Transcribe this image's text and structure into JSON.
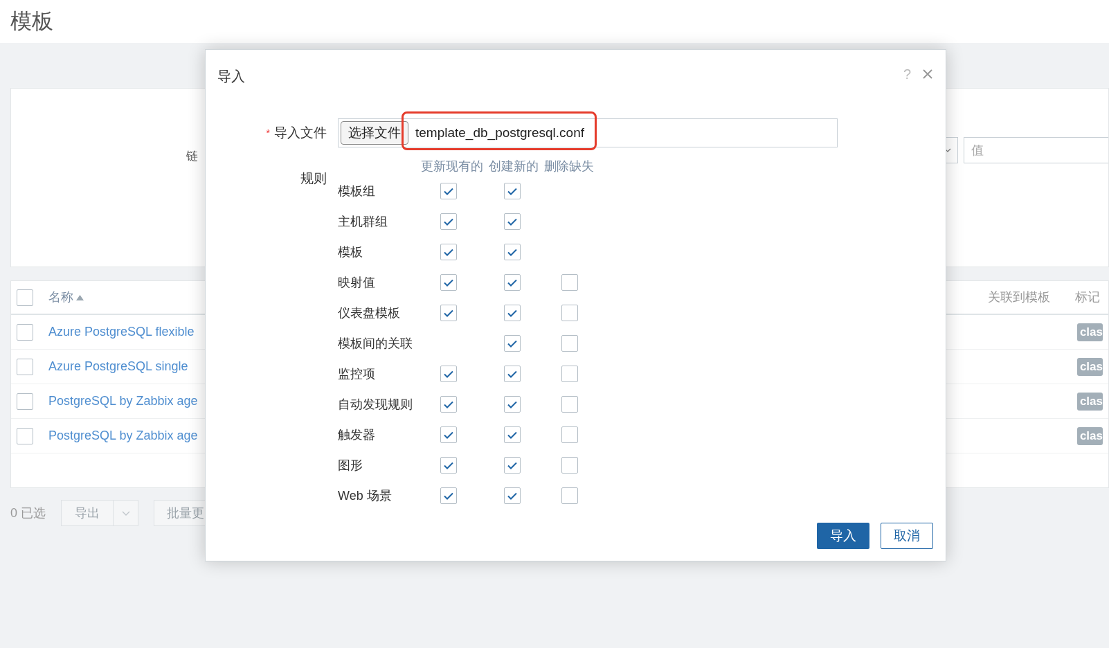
{
  "page": {
    "title": "模板"
  },
  "filter": {
    "label": "链",
    "value_placeholder": "值"
  },
  "table": {
    "header_checked": false,
    "columns": [
      "名称",
      "关联到模板",
      "标记"
    ],
    "rows": [
      {
        "name": "Azure PostgreSQL flexible",
        "tag": "clas",
        "checked": false
      },
      {
        "name": "Azure PostgreSQL single",
        "tag": "clas",
        "checked": false
      },
      {
        "name": "PostgreSQL by Zabbix age",
        "tag": "clas",
        "checked": false
      },
      {
        "name": "PostgreSQL by Zabbix age",
        "tag": "clas",
        "checked": false
      }
    ]
  },
  "footer": {
    "selected_count": "0 已选",
    "export": "导出",
    "mass_update": "批量更"
  },
  "dialog": {
    "title": "导入",
    "help": "?",
    "required_mark": "*",
    "file_label": "导入文件",
    "choose_button": "选择文件",
    "file_name": "template_db_postgresql.conf",
    "rules_label": "规则",
    "rule_columns": [
      "更新现有的",
      "创建新的",
      "删除缺失"
    ],
    "rules": [
      {
        "label": "模板组",
        "update": {
          "checked": true
        },
        "create": {
          "checked": true
        }
      },
      {
        "label": "主机群组",
        "update": {
          "checked": true
        },
        "create": {
          "checked": true
        }
      },
      {
        "label": "模板",
        "update": {
          "checked": true
        },
        "create": {
          "checked": true
        }
      },
      {
        "label": "映射值",
        "update": {
          "checked": true
        },
        "create": {
          "checked": true
        },
        "delete": {
          "checked": false
        }
      },
      {
        "label": "仪表盘模板",
        "update": {
          "checked": true
        },
        "create": {
          "checked": true
        },
        "delete": {
          "checked": false
        }
      },
      {
        "label": "模板间的关联",
        "create": {
          "checked": true
        },
        "delete": {
          "checked": false
        }
      },
      {
        "label": "监控项",
        "update": {
          "checked": true
        },
        "create": {
          "checked": true
        },
        "delete": {
          "checked": false
        }
      },
      {
        "label": "自动发现规则",
        "update": {
          "checked": true
        },
        "create": {
          "checked": true
        },
        "delete": {
          "checked": false
        }
      },
      {
        "label": "触发器",
        "update": {
          "checked": true
        },
        "create": {
          "checked": true
        },
        "delete": {
          "checked": false
        }
      },
      {
        "label": "图形",
        "update": {
          "checked": true
        },
        "create": {
          "checked": true
        },
        "delete": {
          "checked": false
        }
      },
      {
        "label": "Web 场景",
        "update": {
          "checked": true
        },
        "create": {
          "checked": true
        },
        "delete": {
          "checked": false
        }
      }
    ],
    "buttons": [
      {
        "label": "导入",
        "kind": "primary"
      },
      {
        "label": "取消",
        "kind": "secondary"
      }
    ]
  }
}
